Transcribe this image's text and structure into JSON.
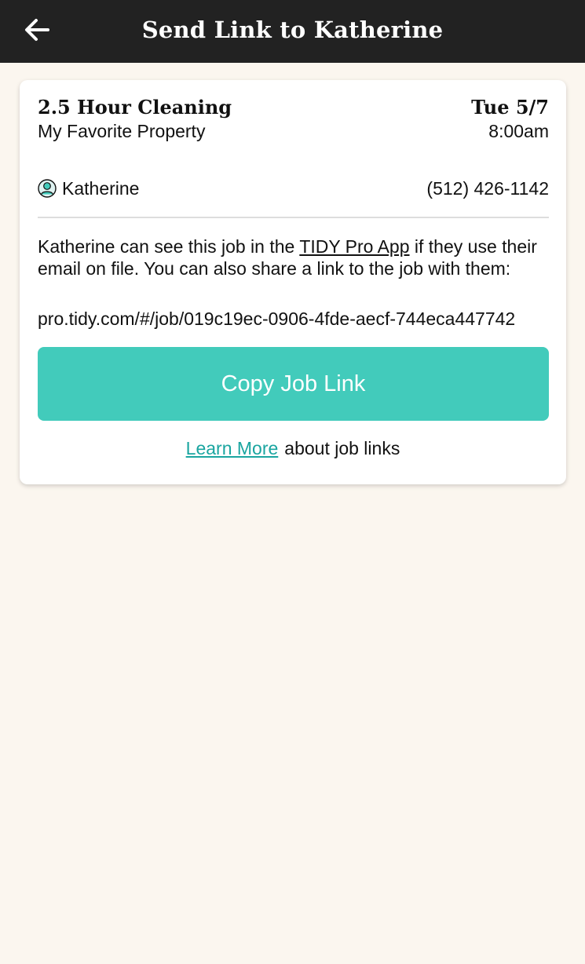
{
  "header": {
    "title": "Send Link to Katherine",
    "back_icon": "arrow-left-icon"
  },
  "job": {
    "title": "2.5 Hour Cleaning",
    "property": "My Favorite Property",
    "date": "Tue 5/7",
    "time": "8:00am"
  },
  "person": {
    "icon": "person-circle-icon",
    "name": "Katherine",
    "phone": "(512) 426-1142"
  },
  "info": {
    "prefix": "Katherine can see this job in the ",
    "app_link": "TIDY Pro App",
    "suffix": " if they use their email on file. You can also share a link to the job with them:",
    "url": "pro.tidy.com/#/job/019c19ec-0906-4fde-aecf-744eca447742"
  },
  "actions": {
    "copy_label": "Copy Job Link",
    "learn_more_label": "Learn More",
    "learn_more_suffix": "about job links"
  },
  "colors": {
    "header_bg": "#222222",
    "page_bg": "#fbf6ef",
    "accent": "#42cbbb",
    "link": "#1aa5a0"
  }
}
